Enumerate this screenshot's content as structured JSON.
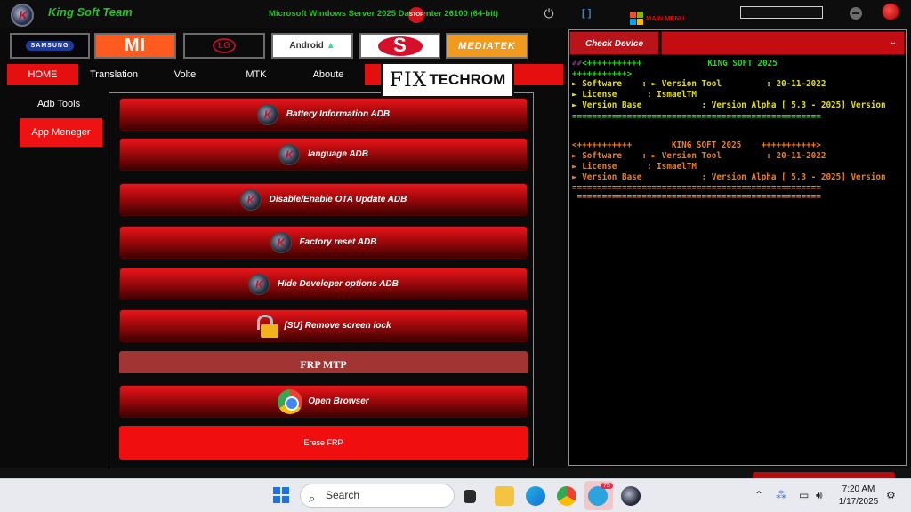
{
  "titlebar": {
    "title": "King Soft Team",
    "os_info": "Microsoft Windows Server 2025 Datacenter 26100 (64-bit)",
    "stop_label": "STOP",
    "brackets": "[ ]",
    "main_menu": "MAIN MENU",
    "power_glyph": "⏻"
  },
  "brands": {
    "samsung": "SAMSUNG",
    "mi": "MI",
    "lg": "LG",
    "android": "Android",
    "snapdragon": "S",
    "mediatek": "MEDIATEK"
  },
  "menu": {
    "items": [
      "HOME",
      "Translation",
      "Volte",
      "MTK",
      "Aboute"
    ],
    "active": "HOME"
  },
  "watermark": {
    "fix": "FIX",
    "tech": "TECHROM"
  },
  "sidebar": {
    "label": "Adb Tools",
    "button": "App Meneger"
  },
  "actions": [
    "Battery Information ADB",
    "language ADB",
    "Disable/Enable OTA Update ADB",
    "Factory reset ADB",
    "Hide Developer options ADB",
    "[SU] Remove screen lock"
  ],
  "frp": {
    "header": "FRP MTP",
    "open_browser": "Open Browser",
    "erase": "Erese FRP"
  },
  "right": {
    "check_device": "Check Device",
    "dropdown_arrow": "⌄"
  },
  "log": {
    "line1a": "<+++++++++++",
    "line1b": "KING SOFT 2025",
    "line2": "+++++++++++>",
    "software": "► Software    : ► Version Tool         : 20-11-2022",
    "license": "► License      : IsmaelTM",
    "version": "► Version Base            : Version Alpha [ 5.3 - 2025] Version",
    "sep": "==================================================",
    "header2": "<+++++++++++        KING SOFT 2025    +++++++++++>",
    "sep2": " ================================================="
  },
  "taskbar": {
    "search": "Search",
    "time": "7:20 AM",
    "date": "1/17/2025",
    "telegram_badge": "75"
  },
  "colors": {
    "accent_red": "#e50f0f",
    "title_green": "#23c41f",
    "log_green": "#1fdc1f",
    "log_orange": "#f07e1d"
  }
}
